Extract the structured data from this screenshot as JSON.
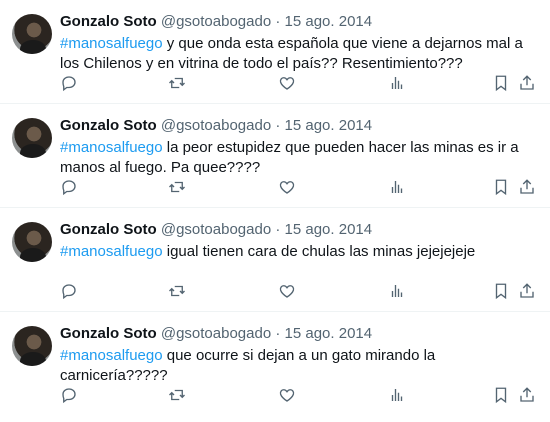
{
  "colors": {
    "hashtag": "#1d9bf0",
    "muted": "#536471",
    "text": "#0f1419"
  },
  "tweets": [
    {
      "name": "Gonzalo Soto",
      "handle": "@gsotoabogado",
      "separator": "·",
      "date": "15 ago. 2014",
      "hashtag": "#manosalfuego",
      "text": " y que onda esta española que viene a dejarnos mal a los Chilenos y en vitrina de todo el país?? Resentimiento???"
    },
    {
      "name": "Gonzalo Soto",
      "handle": "@gsotoabogado",
      "separator": "·",
      "date": "15 ago. 2014",
      "hashtag": "#manosalfuego",
      "text": " la peor estupidez que pueden hacer las minas es ir a manos al fuego. Pa quee????"
    },
    {
      "name": "Gonzalo Soto",
      "handle": "@gsotoabogado",
      "separator": "·",
      "date": "15 ago. 2014",
      "hashtag": "#manosalfuego",
      "text": " igual tienen cara de chulas las minas jejejejeje"
    },
    {
      "name": "Gonzalo Soto",
      "handle": "@gsotoabogado",
      "separator": "·",
      "date": "15 ago. 2014",
      "hashtag": "#manosalfuego",
      "text": " que ocurre si dejan a un gato mirando la carnicería?????"
    }
  ],
  "actions": [
    "reply-icon",
    "retweet-icon",
    "like-icon",
    "views-icon",
    "bookmark-icon",
    "share-icon"
  ]
}
